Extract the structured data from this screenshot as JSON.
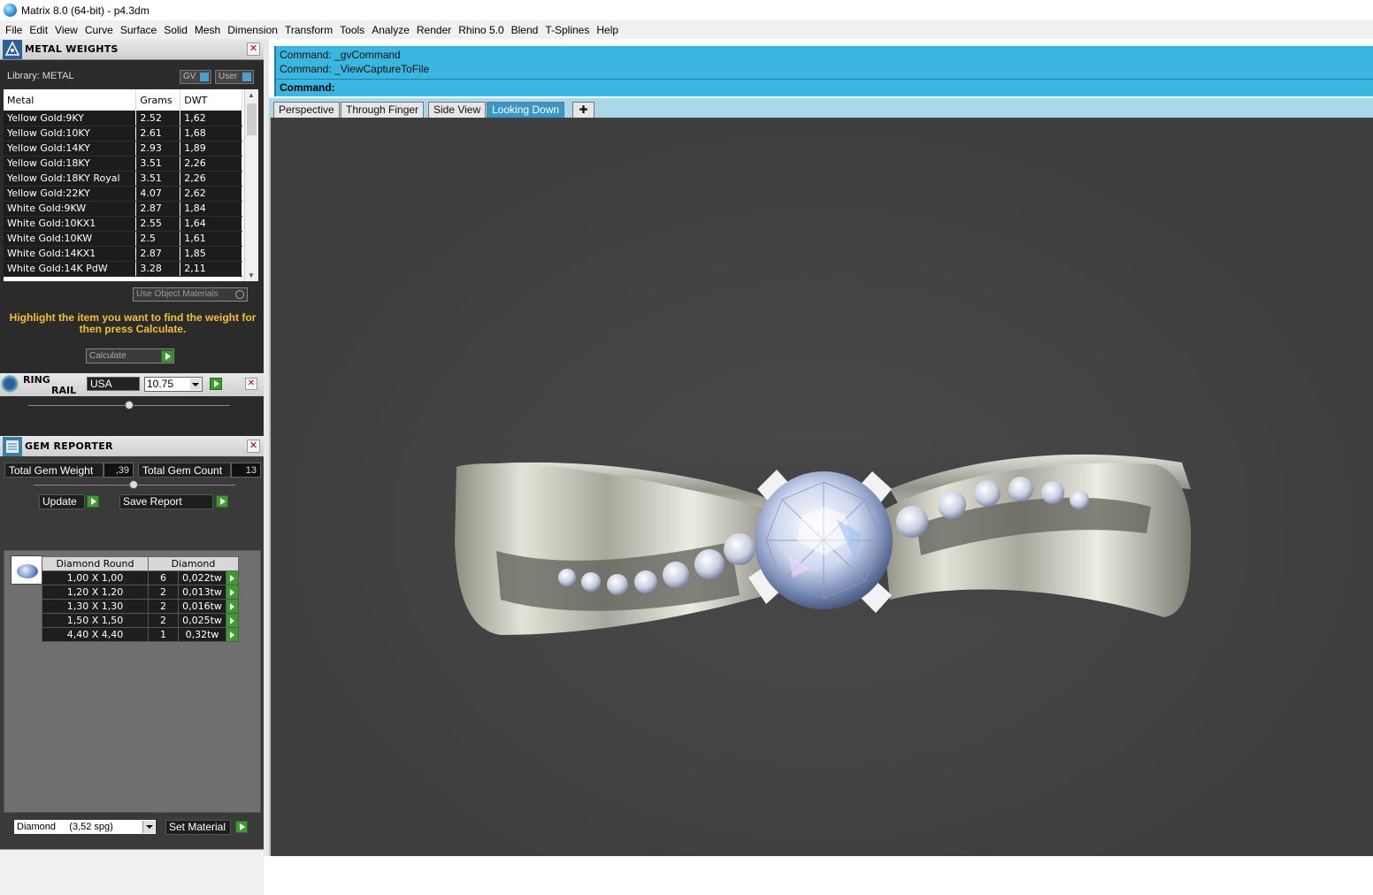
{
  "window": {
    "title": "Matrix 8.0 (64-bit) - p4.3dm"
  },
  "menu": [
    "File",
    "Edit",
    "View",
    "Curve",
    "Surface",
    "Solid",
    "Mesh",
    "Dimension",
    "Transform",
    "Tools",
    "Analyze",
    "Render",
    "Rhino 5.0",
    "Blend",
    "T-Splines",
    "Help"
  ],
  "metal_weights": {
    "title": "METAL WEIGHTS",
    "library_label": "Library: METAL",
    "toggle_gv": "GV",
    "toggle_user": "User",
    "columns": [
      "Metal",
      "Grams",
      "DWT"
    ],
    "rows": [
      [
        "Yellow Gold:9KY",
        "2.52",
        "1,62"
      ],
      [
        "Yellow Gold:10KY",
        "2.61",
        "1,68"
      ],
      [
        "Yellow Gold:14KY",
        "2.93",
        "1,89"
      ],
      [
        "Yellow Gold:18KY",
        "3.51",
        "2,26"
      ],
      [
        "Yellow Gold:18KY Royal",
        "3.51",
        "2,26"
      ],
      [
        "Yellow Gold:22KY",
        "4.07",
        "2,62"
      ],
      [
        "White Gold:9KW",
        "2.87",
        "1,84"
      ],
      [
        "White Gold:10KX1",
        "2.55",
        "1,64"
      ],
      [
        "White Gold:10KW",
        "2.5",
        "1,61"
      ],
      [
        "White Gold:14KX1",
        "2.87",
        "1,85"
      ],
      [
        "White Gold:14K PdW",
        "3.28",
        "2,11"
      ]
    ],
    "use_object_materials": "Use Object Materials",
    "hint": "Highlight the item you want to find the weight for then press Calculate.",
    "calculate": "Calculate"
  },
  "ring_rail": {
    "title_1": "RING",
    "title_2": "RAIL",
    "standard": "USA",
    "size": "10.75"
  },
  "gem_reporter": {
    "title": "GEM REPORTER",
    "total_weight_label": "Total Gem Weight",
    "total_weight": ",39",
    "total_count_label": "Total Gem Count",
    "total_count": "13",
    "update": "Update",
    "save_report": "Save Report",
    "columns": [
      "Diamond Round",
      "Diamond"
    ],
    "rows": [
      [
        "1,00 X 1,00",
        "6",
        "0,022tw"
      ],
      [
        "1,20 X 1,20",
        "2",
        "0,013tw"
      ],
      [
        "1,30 X 1,30",
        "2",
        "0,016tw"
      ],
      [
        "1,50 X 1,50",
        "2",
        "0,025tw"
      ],
      [
        "4,40 X 4,40",
        "1",
        "0,32tw"
      ]
    ],
    "material": "Diamond     (3,52 spg)",
    "set_material": "Set Material"
  },
  "command": {
    "history": [
      "Command: _gvCommand",
      "Command: _ViewCaptureToFile"
    ],
    "prompt": "Command:"
  },
  "viewport_tabs": [
    "Perspective",
    "Through Finger",
    "Side View",
    "Looking Down"
  ],
  "active_tab": "Looking Down",
  "colors": {
    "command_bg": "#3bb6e0",
    "active_tab": "#3a98c8",
    "hint_text": "#f0c030",
    "go_button": "#3c9a30"
  }
}
